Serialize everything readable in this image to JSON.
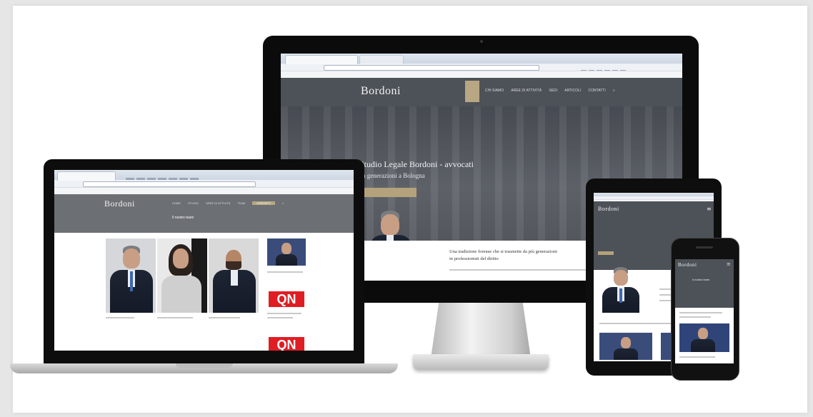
{
  "site": {
    "logo": "Bordoni",
    "hero_title": "Studio Legale Bordoni - avvocati",
    "hero_subtitle": "da generazioni a Bologna",
    "intro_text_line1": "Una tradizione forense che si trasmette da più generazioni",
    "intro_text_line2": "in professionisti del diritto",
    "qn_logo": "QN",
    "laptop_section_title": "Il nostro team"
  },
  "monitor_nav": [
    "CHI SIAMO",
    "AREE DI ATTIVITÀ",
    "SEDI",
    "ARTICOLI",
    "CONTATTI"
  ],
  "laptop_nav": [
    "HOME",
    "STUDIO",
    "AREE DI ATTIVITÀ",
    "TEAM",
    "CONTATTI"
  ],
  "colors": {
    "gold": "#b3a27c",
    "header_dark": "#4d5158",
    "qn_red": "#e01d24"
  },
  "icons": [
    "search-icon",
    "apple-logo-icon"
  ]
}
